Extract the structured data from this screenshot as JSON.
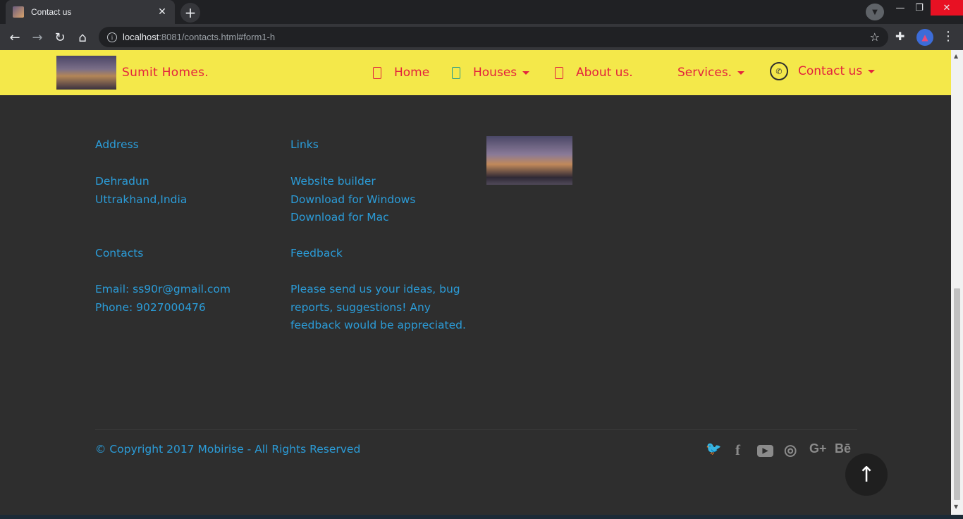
{
  "browser": {
    "tab_title": "Contact us",
    "tab_close": "✕",
    "new_tab": "+",
    "url_host": "localhost",
    "url_rest": ":8081/contacts.html#form1-h",
    "info": "i"
  },
  "navbar": {
    "brand": "Sumit Homes.",
    "items": [
      {
        "label": "Home"
      },
      {
        "label": "Houses"
      },
      {
        "label": "About us."
      },
      {
        "label": "Services."
      },
      {
        "label": "Contact us"
      }
    ]
  },
  "footer": {
    "address": {
      "heading": "Address",
      "line1": "Dehradun",
      "line2": "Uttrakhand,India"
    },
    "links": {
      "heading": "Links",
      "items": [
        "Website builder",
        "Download for Windows",
        "Download for Mac"
      ]
    },
    "contacts": {
      "heading": "Contacts",
      "email": "Email: ss90r@gmail.com",
      "phone": "Phone: 9027000476"
    },
    "feedback": {
      "heading": "Feedback",
      "line1": "Please send us your ideas, bug",
      "line2": "reports, suggestions! Any",
      "line3": "feedback would be appreciated."
    },
    "copyright": "© Copyright 2017 Mobirise - All Rights Reserved",
    "social": [
      "twitter-icon",
      "facebook-icon",
      "youtube-icon",
      "instagram-icon",
      "google-plus-icon",
      "behance-icon"
    ],
    "social_glyphs": [
      "🐦",
      "f",
      "▶",
      "◎",
      "G+",
      "Bē"
    ]
  },
  "colors": {
    "navbar_bg": "#f4e84a",
    "nav_text": "#e3233d",
    "footer_bg": "#2e2e2e",
    "link_text": "#2b9cd8"
  }
}
